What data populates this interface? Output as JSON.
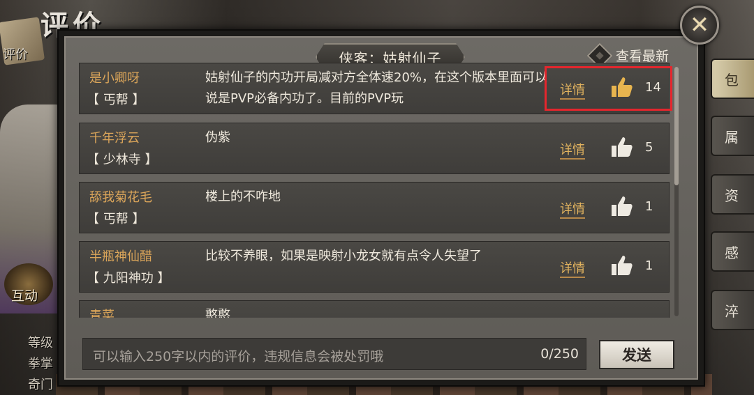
{
  "background": {
    "page_heading": "评价",
    "left_book_label": "评价",
    "interact_label": "互动",
    "left_small": [
      "等级",
      "拳掌",
      "奇门"
    ],
    "right_tabs": [
      "包",
      "属",
      "资",
      "感",
      "淬"
    ]
  },
  "dialog": {
    "title": "侠客：姑射仙子",
    "check_latest_label": "查看最新",
    "close_icon": "close-icon",
    "detail_label": "详情",
    "comments": [
      {
        "name": "是小卿呀",
        "sect": "【 丐帮 】",
        "text": "姑射仙子的内功开局减对方全体速20%，在这个版本里面可以说是PVP必备内功了。目前的PVP玩",
        "likes": "14",
        "liked": true
      },
      {
        "name": "千年浮云",
        "sect": "【 少林寺 】",
        "text": "伪紫",
        "likes": "5",
        "liked": false
      },
      {
        "name": "舔我菊花毛",
        "sect": "【 丐帮 】",
        "text": "楼上的不咋地",
        "likes": "1",
        "liked": false
      },
      {
        "name": "半瓶神仙醋",
        "sect": "【 九阳神功 】",
        "text": "比较不养眼，如果是映射小龙女就有点令人失望了",
        "likes": "1",
        "liked": false
      },
      {
        "name": "青菜",
        "sect": "",
        "text": "憨憨",
        "likes": "",
        "liked": false
      }
    ],
    "input": {
      "placeholder": "可以输入250字以内的评价，违规信息会被处罚哦",
      "counter": "0/250"
    },
    "send_label": "发送",
    "colors": {
      "name": "#dca65a",
      "liked": "#e8b54f",
      "highlight": "#e5262d"
    }
  }
}
